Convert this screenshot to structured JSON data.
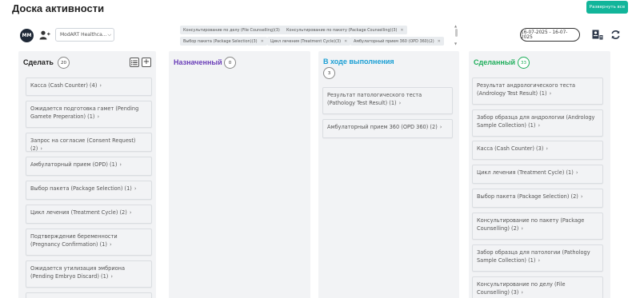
{
  "header": {
    "title": "Доска активности",
    "expand_label": "Развернуть все"
  },
  "toolbar": {
    "avatar_initials": "MM",
    "facility_select": "ModART Healthca...",
    "date_range": "16-07-2025 - 16-07-2025"
  },
  "filters": [
    "Консультирование по делу (File Counselling)(3)",
    "Консультирование по пакету (Package Counselling)(3)",
    "Выбор пакета (Package Selection)(3)",
    "Цикл лечения (Treatment Cycle)(3)",
    "Амбулаторный прием 360 (OPD 360)(2)"
  ],
  "columns": [
    {
      "title": "Сделать",
      "count": "20",
      "color": "#222222",
      "cards": [
        "Касса (Cash Counter) (4)",
        "Ожидается подготовка гамет (Pending Gamete Preperation) (1)",
        "Запрос на согласие (Consent Request) (2)",
        "Амбулаторный прием (OPD) (1)",
        "Выбор пакета (Package Selection) (1)",
        "Цикл лечения (Treatment Cycle) (2)",
        "Подтверждение беременности (Pregnancy Confirmation) (1)",
        "Ожидается утилизация эмбриона (Pending Embryo Discard) (1)"
      ]
    },
    {
      "title": "Назначенный",
      "count": "0",
      "color": "#6b3fb8",
      "cards": []
    },
    {
      "title": "В ходе выполнения",
      "count": "3",
      "color": "#1a9fd4",
      "cards": [
        "Результат патологического теста (Pathology Test Result) (1)",
        "Амбулаторный прием 360 (OPD 360) (2)"
      ]
    },
    {
      "title": "Сделанный",
      "count": "33",
      "color": "#1fae5b",
      "cards": [
        "Результат андрологического теста (Andrology Test Result) (1)",
        "Забор образца для андрологии (Andrology Sample Collection) (1)",
        "Касса (Cash Counter) (3)",
        "Цикл лечения (Treatment Cycle) (1)",
        "Выбор пакета (Package Selection) (2)",
        "Консультирование по пакету (Package Counselling) (2)",
        "Забор образца для патологии (Pathology Sample Collection) (1)",
        "Консультирование по делу (File Counselling) (3)"
      ]
    }
  ],
  "colors": {
    "accent": "#12b59a",
    "done_badge": "#1fae5b"
  }
}
